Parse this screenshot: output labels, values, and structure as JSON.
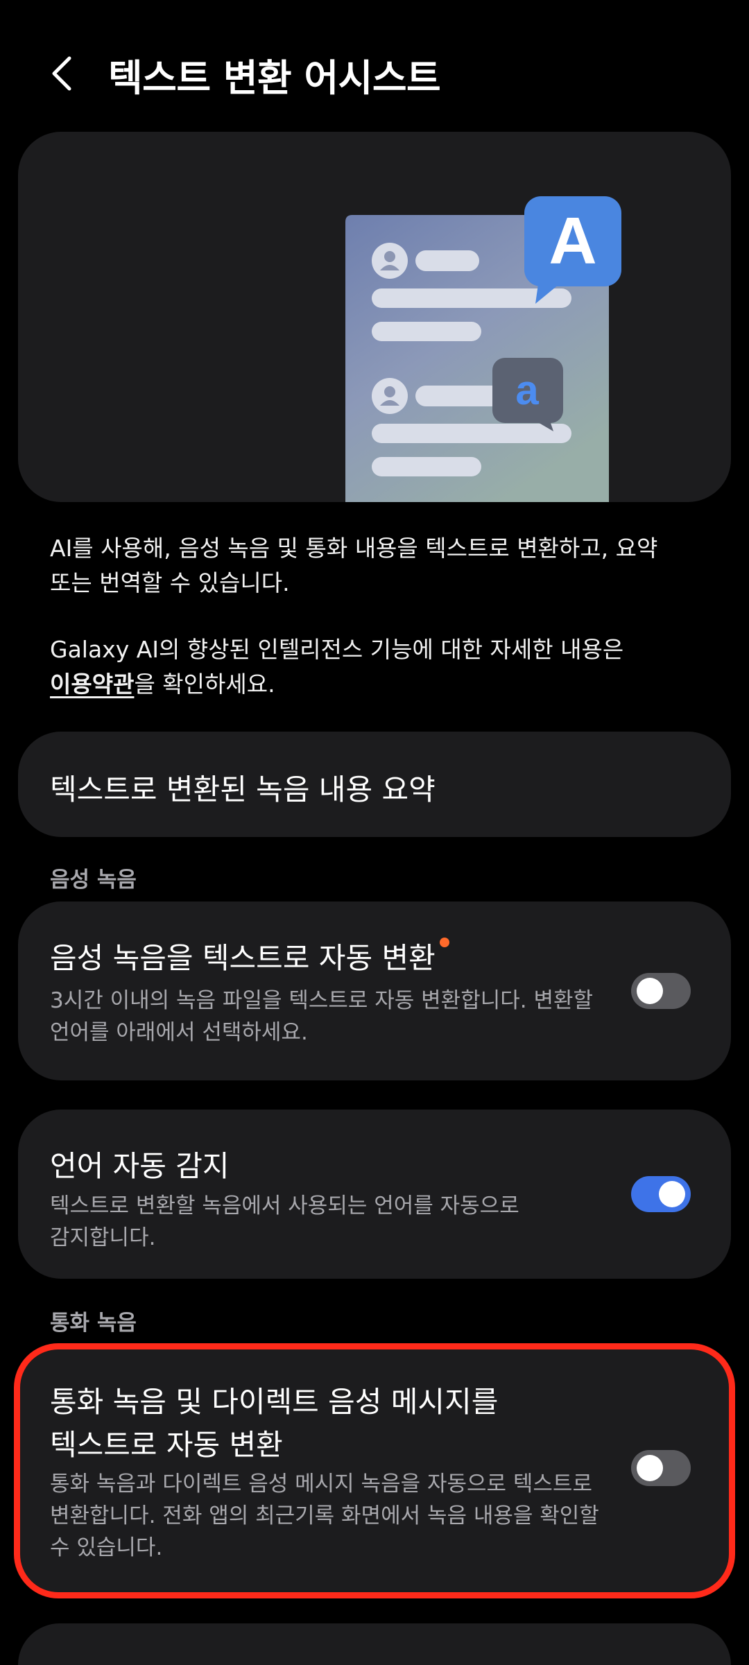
{
  "header": {
    "title": "텍스트 변환 어시스트"
  },
  "hero": {
    "big_letter": "A",
    "small_letter": "a"
  },
  "description": {
    "paragraph1_line1": "AI를 사용해, 음성 녹음 및 통화 내용을 텍스트로 변환하고, 요약",
    "paragraph1_line2": "또는 번역할 수 있습니다.",
    "paragraph2_line1": "Galaxy AI의 향상된 인텔리전스 기능에 대한 자세한 내용은",
    "paragraph2_link": "이용약관",
    "paragraph2_rest": "을 확인하세요."
  },
  "summary_card": {
    "title": "텍스트로 변환된 녹음 내용 요약"
  },
  "voice_recording": {
    "section_label": "음성 녹음",
    "auto_transcribe": {
      "title": "음성 녹음을 텍스트로 자동 변환",
      "subtitle_line1": "3시간 이내의 녹음 파일을 텍스트로 자동 변환합니다. 변환할",
      "subtitle_line2": "언어를 아래에서 선택하세요.",
      "enabled": false
    },
    "language_detect": {
      "title": "언어 자동 감지",
      "subtitle_line1": "텍스트로 변환할 녹음에서 사용되는 언어를 자동으로",
      "subtitle_line2": "감지합니다.",
      "enabled": true
    }
  },
  "call_recording": {
    "section_label": "통화 녹음",
    "auto_transcribe": {
      "title_line1": "통화 녹음 및 다이렉트 음성 메시지를",
      "title_line2": "텍스트로 자동 변환",
      "subtitle_line1": "통화 녹음과 다이렉트 음성 메시지 녹음을 자동으로 텍스트로",
      "subtitle_line2": "변환합니다. 전화 앱의 최근기록 화면에서 녹음 내용을 확인할",
      "subtitle_line3": "수 있습니다.",
      "enabled": false
    }
  },
  "colors": {
    "background": "#000000",
    "card": "#1c1c1e",
    "accent": "#3e73e8",
    "highlight": "#ff2a1a",
    "new_dot": "#ff6a2b"
  },
  "icons": {
    "back": "chevron-left-icon",
    "waveform": "waveform-icon",
    "translate": "translate-bubble-icon",
    "avatar": "person-icon"
  }
}
